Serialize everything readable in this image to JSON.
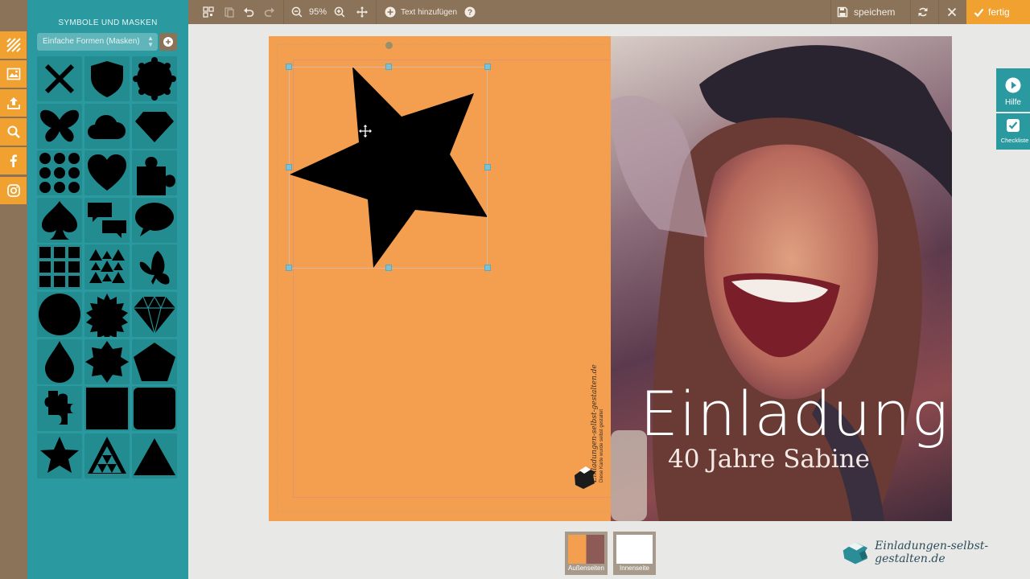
{
  "panel": {
    "title": "SYMBOLE UND MASKEN",
    "select_value": "Einfache Formen (Masken)",
    "shapes": [
      "x",
      "shield",
      "scallop-circle",
      "butterfly",
      "cloud",
      "diamond",
      "dots",
      "heart",
      "puzzle",
      "spade",
      "speech-double",
      "speech",
      "squares",
      "triangles",
      "butterfly-side",
      "circle",
      "sun-burst",
      "gem",
      "drop",
      "star-8",
      "pentagon",
      "puzzle-2",
      "square",
      "rounded-square",
      "star-5",
      "triangle-pattern",
      "triangle"
    ]
  },
  "toolbar": {
    "zoom": "95%",
    "add_text": "Text hinzufügen",
    "save": "speichem",
    "done": "fertig"
  },
  "side": {
    "help": "Hilfe",
    "checklist": "Checkliste"
  },
  "card": {
    "brand_vertical": "Einladungen-selbst-gestalten.de",
    "brand_sub": "Diese Karte wurde selbst gestaltet",
    "title": "Einladung",
    "subtitle": "40 Jahre Sabine"
  },
  "pages": {
    "outer": "Außenseiten",
    "inner": "Innenseite"
  },
  "brand": "Einladungen-selbst-gestalten.de",
  "colors": {
    "orange": "#f1a130",
    "teal": "#2a9aa0",
    "brown": "#8a7359",
    "card": "#f49f4f"
  }
}
